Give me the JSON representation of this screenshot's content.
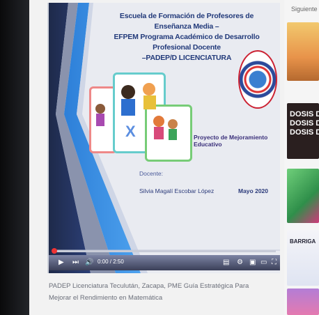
{
  "slide": {
    "title_lines": [
      "Escuela de Formación de Profesores de Enseñanza Media –",
      "EFPEM Programa Académico de Desarrollo Profesional Docente",
      "–PADEP/D LICENCIATURA"
    ],
    "project": "Proyecto de Mejoramiento Educativo",
    "teacher_label": "Docente:",
    "teacher_name": "Silvia Magalí Escobar López",
    "date": "Mayo 2020"
  },
  "player": {
    "time": "0:00 / 2:50",
    "progress_fraction": 0.0
  },
  "caption": "PADEP Licenciatura Teculután, Zacapa, PME Guía Estratégica Para Mejorar el Rendimiento en Matemática",
  "sidebar": {
    "next_label": "Siguiente",
    "thumb_text": "DOSIS D\nDOSIS D\nDOSIS D",
    "thumb_text2": "BARRIGA"
  },
  "colors": {
    "title_blue": "#223a7a",
    "slide_bg": "#e9ebf1",
    "progress_red": "#e33"
  }
}
